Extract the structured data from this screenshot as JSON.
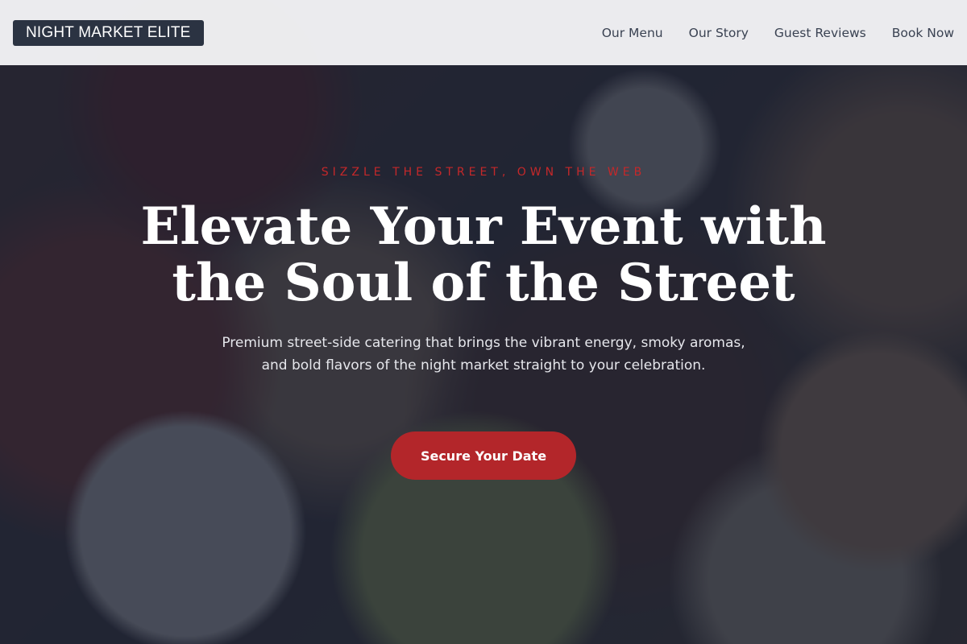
{
  "nav": {
    "brand": "NIGHT MARKET ELITE",
    "links": [
      {
        "label": "Our Menu"
      },
      {
        "label": "Our Story"
      },
      {
        "label": "Guest Reviews"
      },
      {
        "label": "Book Now"
      }
    ]
  },
  "hero": {
    "eyebrow": "SIZZLE THE STREET, OWN THE WEB",
    "headline": "Elevate Your Event with the Soul of the Street",
    "subtitle": "Premium street-side catering that brings the vibrant energy, smoky aromas, and bold flavors of the night market straight to your celebration.",
    "cta_label": "Secure Your Date",
    "background_image": "food-platter-photo"
  },
  "colors": {
    "accent": "#b3262a",
    "eyebrow": "#c5282a",
    "nav_background": "#f8f8fa",
    "brand_background": "#2b3342"
  }
}
